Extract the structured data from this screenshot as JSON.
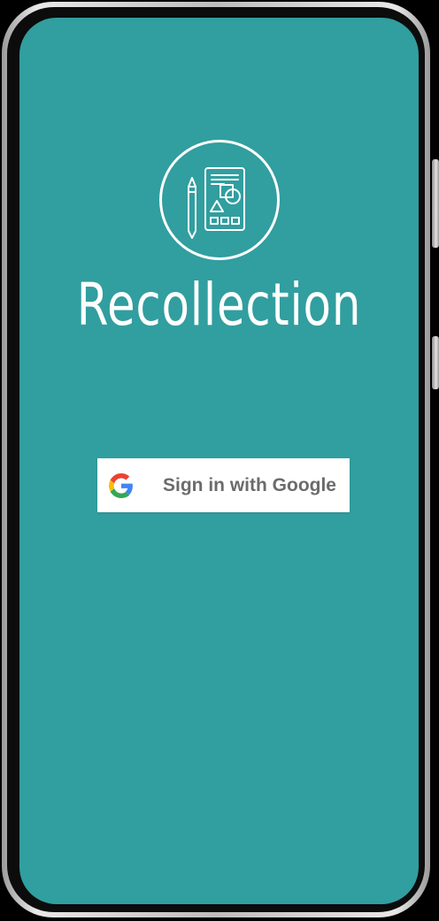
{
  "app": {
    "title": "Recollection",
    "logo_icon": "notebook-pencil-shapes-icon"
  },
  "signin": {
    "label": "Sign in with Google",
    "icon": "google-g-icon"
  },
  "colors": {
    "screen_background": "#319E9F",
    "logo_stroke": "#FFFFFF",
    "button_background": "#FFFFFF",
    "button_text": "#6B6B6B",
    "google_blue": "#4285F4",
    "google_red": "#EA4335",
    "google_yellow": "#FBBC05",
    "google_green": "#34A853"
  }
}
